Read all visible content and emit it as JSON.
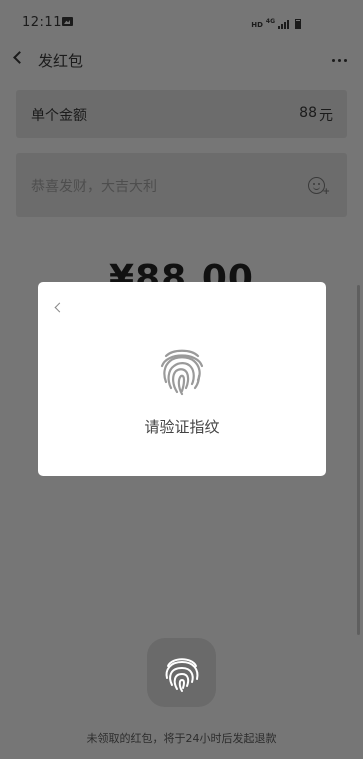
{
  "status_bar": {
    "time": "12:11",
    "network_hd": "HD",
    "network_gen": "4G"
  },
  "header": {
    "title": "发红包"
  },
  "amount_row": {
    "label": "单个金额",
    "value": "88",
    "unit": "元"
  },
  "greeting_row": {
    "placeholder": "恭喜发财，大吉大利"
  },
  "big_amount": "¥88.00",
  "dialog": {
    "prompt": "请验证指纹"
  },
  "footer_note": "未领取的红包，将于24小时后发起退款",
  "icons": {
    "status_gallery": "gallery-icon",
    "back": "back-icon",
    "more": "more-icon",
    "emoji": "emoji-icon",
    "fingerprint": "fingerprint-icon"
  },
  "colors": {
    "overlay_bg": "#767676",
    "dialog_bg": "#ffffff",
    "text_dark": "#1b1b1b"
  }
}
